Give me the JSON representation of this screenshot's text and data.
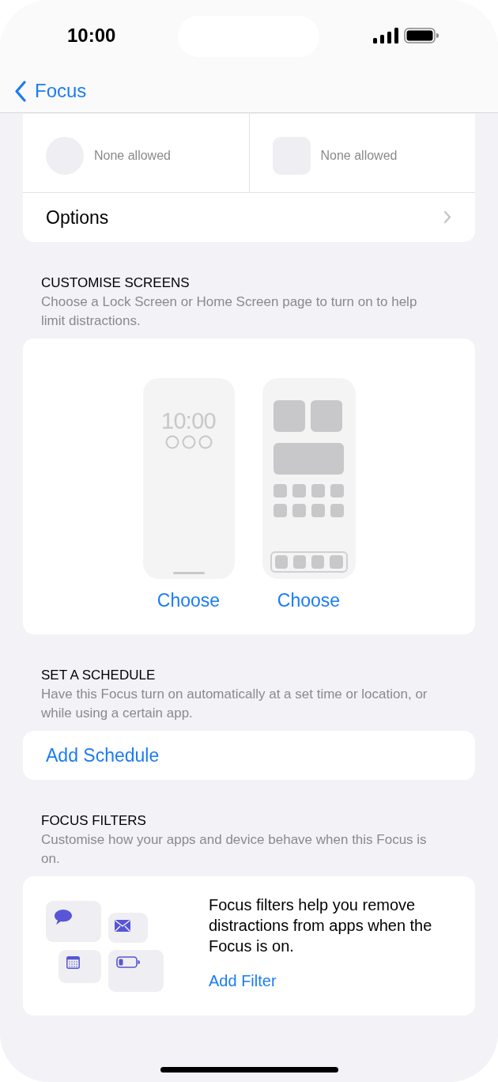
{
  "status_bar": {
    "time": "10:00"
  },
  "nav": {
    "back_label": "Focus"
  },
  "allowed": [
    {
      "kind": "people",
      "value": "None allowed"
    },
    {
      "kind": "apps",
      "value": "None allowed"
    }
  ],
  "options": {
    "label": "Options"
  },
  "customise": {
    "header": "CUSTOMISE SCREENS",
    "description": "Choose a Lock Screen or Home Screen page to turn on to help limit distractions.",
    "screens": [
      {
        "kind": "lock",
        "clock": "10:00",
        "action": "Choose"
      },
      {
        "kind": "home",
        "action": "Choose"
      }
    ]
  },
  "schedule": {
    "header": "SET A SCHEDULE",
    "description": "Have this Focus turn on automatically at a set time or location, or while using a certain app.",
    "action": "Add Schedule"
  },
  "filters": {
    "header": "FOCUS FILTERS",
    "description": "Customise how your apps and device behave when this Focus is on.",
    "text": "Focus filters help you remove distractions from apps when the Focus is on.",
    "action": "Add Filter"
  }
}
